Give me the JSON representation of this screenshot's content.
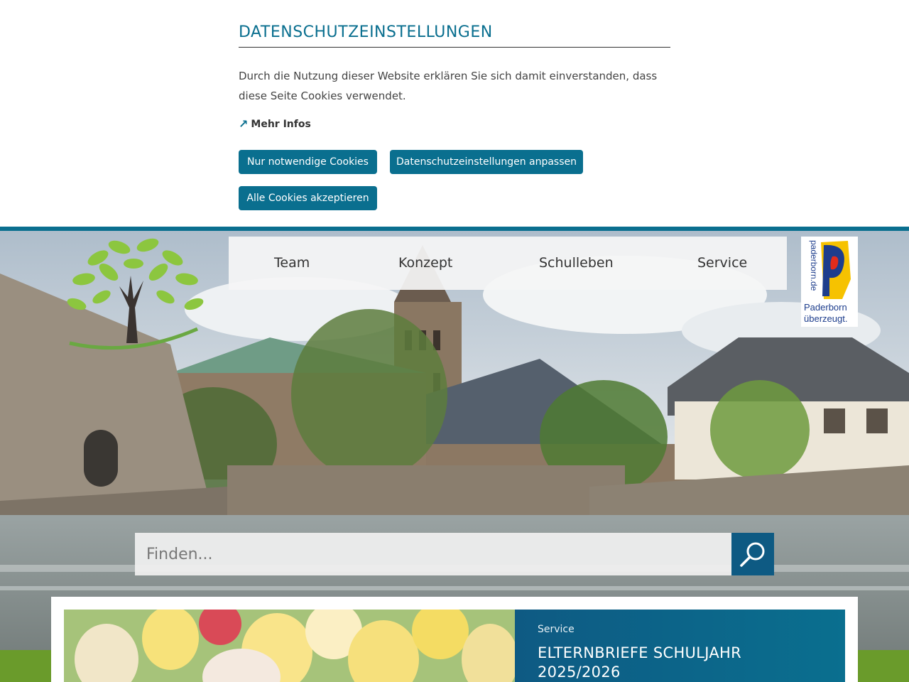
{
  "cookie": {
    "title": "DATENSCHUTZEINSTELLUNGEN",
    "text": "Durch die Nutzung dieser Website erklären Sie sich damit einverstanden, dass diese Seite Cookies verwendet.",
    "more_link": "Mehr Infos",
    "btn_necessary": "Nur notwendige Cookies",
    "btn_customize": "Datenschutzeinstellungen anpassen",
    "btn_accept_all": "Alle Cookies akzeptieren"
  },
  "nav": {
    "items": [
      {
        "label": "Team"
      },
      {
        "label": "Konzept"
      },
      {
        "label": "Schulleben"
      },
      {
        "label": "Service"
      }
    ]
  },
  "badge": {
    "url_text": "paderborn.de",
    "line1": "Paderborn",
    "line2": "überzeugt."
  },
  "search": {
    "placeholder": "Finden..."
  },
  "teaser": {
    "category": "Service",
    "title": "ELTERNBRIEFE SCHULJAHR 2025/2026"
  },
  "colors": {
    "accent": "#0a6f8f",
    "dark_accent": "#0e5a83",
    "green": "#6a9b2b"
  },
  "icons": [
    "external-arrow-icon",
    "tree-logo",
    "search-icon",
    "paderborn-badge"
  ]
}
